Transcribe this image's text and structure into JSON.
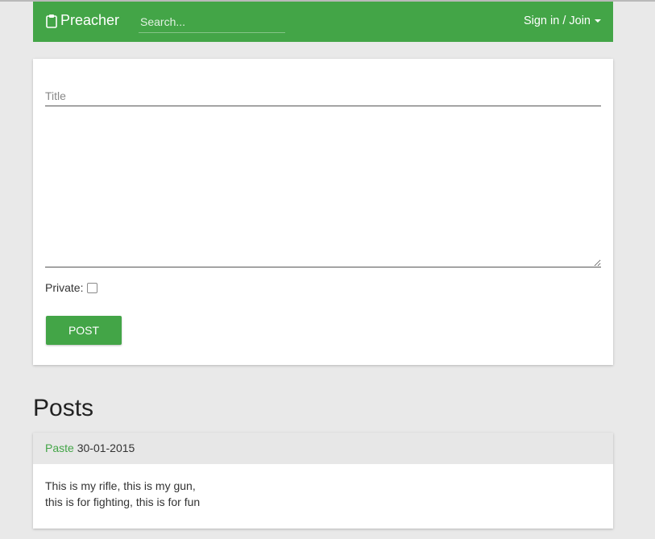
{
  "navbar": {
    "brand": "Preacher",
    "search_placeholder": "Search...",
    "signin_label": "Sign in / Join"
  },
  "form": {
    "title_placeholder": "Title",
    "body_value": "",
    "private_label": "Private:",
    "private_checked": false,
    "post_button": "POST"
  },
  "posts": {
    "heading": "Posts",
    "items": [
      {
        "link": "Paste",
        "date": "30-01-2015",
        "lines": [
          "This is my rifle, this is my gun,",
          "this is for fighting, this is for fun"
        ]
      }
    ]
  },
  "colors": {
    "accent": "#43a547",
    "background": "#e9e9e9"
  },
  "icons": {
    "brand_icon": "clipboard-icon",
    "dropdown_icon": "caret-down-icon"
  }
}
